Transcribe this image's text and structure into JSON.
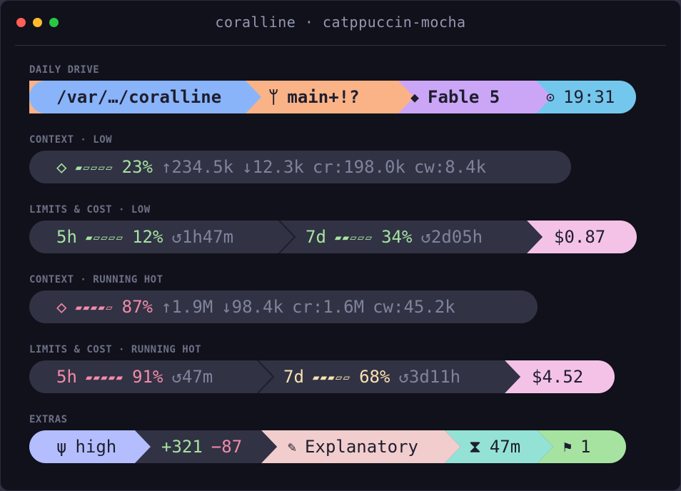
{
  "window": {
    "title": "coralline · catppuccin-mocha"
  },
  "rows": {
    "daily": {
      "label": "DAILY DRIVE",
      "path": "/var/…/coralline",
      "git_icon": "ᛘ",
      "branch": "main+!?",
      "model_icon": "◆",
      "model": "Fable 5",
      "clock_icon": "⊙",
      "time": "19:31"
    },
    "context_low": {
      "label": "CONTEXT · LOW",
      "icon": "◇",
      "meter": "▰▱▱▱▱",
      "pct": "23%",
      "up": "↑234.5k",
      "down": "↓12.3k",
      "cr": "cr:198.0k",
      "cw": "cw:8.4k"
    },
    "limits_low": {
      "label": "LIMITS & COST · LOW",
      "h5": "5h",
      "h5_meter": "▰▱▱▱▱",
      "h5_pct": "12%",
      "h5_reset": "↺1h47m",
      "d7": "7d",
      "d7_meter": "▰▰▱▱▱",
      "d7_pct": "34%",
      "d7_reset": "↺2d05h",
      "cost": "$0.87"
    },
    "context_hot": {
      "label": "CONTEXT · RUNNING HOT",
      "icon": "◇",
      "meter": "▰▰▰▰▱",
      "pct": "87%",
      "up": "↑1.9M",
      "down": "↓98.4k",
      "cr": "cr:1.6M",
      "cw": "cw:45.2k"
    },
    "limits_hot": {
      "label": "LIMITS & COST · RUNNING HOT",
      "h5": "5h",
      "h5_meter": "▰▰▰▰▰",
      "h5_pct": "91%",
      "h5_reset": "↺47m",
      "d7": "7d",
      "d7_meter": "▰▰▰▱▱",
      "d7_pct": "68%",
      "d7_reset": "↺3d11h",
      "cost": "$4.52"
    },
    "extras": {
      "label": "EXTRAS",
      "effort_icon": "ψ",
      "effort": "high",
      "added": "+321",
      "removed": "−87",
      "style_icon": "✎",
      "style": "Explanatory",
      "timer_icon": "⧗",
      "duration": "47m",
      "flag_icon": "⚑",
      "flags": "1"
    }
  },
  "colors": {
    "base": "#11111b",
    "surface": "#313244",
    "blue": "#89b4fa",
    "peach": "#fab387",
    "mauve": "#cba6f7",
    "sapphire": "#74c7ec",
    "green": "#a6e3a1",
    "red": "#f38ba8",
    "yellow": "#f9e2af",
    "pink": "#f5c2e7",
    "lavender": "#b4befe",
    "flamingo": "#f2cdcd",
    "teal": "#94e2d5",
    "overlay": "#6c7086"
  }
}
